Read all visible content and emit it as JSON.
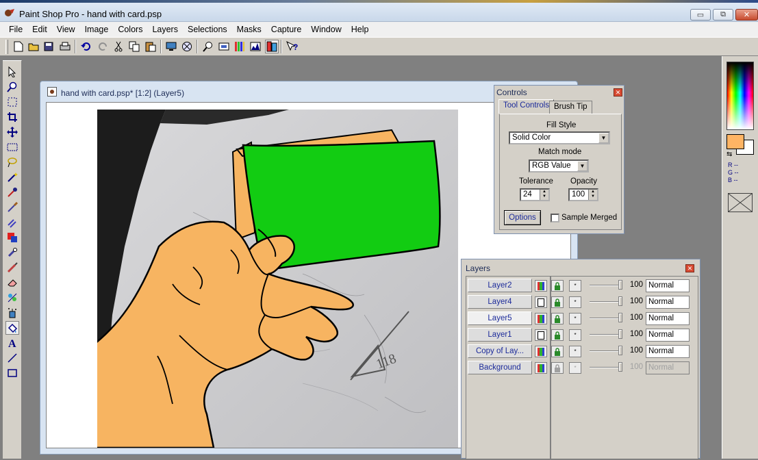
{
  "app": {
    "title": "Paint Shop Pro - hand with card.psp",
    "window_buttons": {
      "minimize": "▭",
      "restore": "⧉",
      "close": "✕"
    }
  },
  "menu": [
    "File",
    "Edit",
    "View",
    "Image",
    "Colors",
    "Layers",
    "Selections",
    "Masks",
    "Capture",
    "Window",
    "Help"
  ],
  "toolbar": [
    "new-icon",
    "open-icon",
    "save-icon",
    "print-icon",
    "undo-icon",
    "redo-icon",
    "cut-icon",
    "copy-icon",
    "paste-icon",
    "screen-icon",
    "browse-icon",
    "zoom-icon",
    "overview-icon",
    "histogram-icon",
    "color-icon",
    "toggle-palettes-icon",
    "help-icon"
  ],
  "tools": [
    "arrow-tool-icon",
    "zoom-tool-icon",
    "deform-tool-icon",
    "crop-tool-icon",
    "mover-tool-icon",
    "selection-tool-icon",
    "freehand-tool-icon",
    "magic-wand-icon",
    "dropper-icon",
    "paint-brush-icon",
    "clone-brush-icon",
    "color-replacer-icon",
    "retouch-icon",
    "scratch-remover-icon",
    "eraser-icon",
    "picture-tube-icon",
    "airbrush-icon",
    "flood-fill-icon",
    "text-tool-icon",
    "line-tool-icon",
    "shapes-tool-icon"
  ],
  "colors": {
    "foreground": "#ffb464",
    "background": "#ffffff",
    "card_green": "#12cc12",
    "hand_tan": "#f7b461",
    "accent_blue": "#1b2a9a"
  },
  "color_readout": {
    "r": "R --",
    "g": "G --",
    "b": "B --"
  },
  "document": {
    "title": "hand with card.psp* [1:2] (Layer5)"
  },
  "controls": {
    "title": "Controls",
    "tabs": [
      "Tool Controls",
      "Brush Tip"
    ],
    "active_tab": "Tool Controls",
    "fill_style_label": "Fill Style",
    "fill_style_value": "Solid Color",
    "match_mode_label": "Match mode",
    "match_mode_value": "RGB Value",
    "tolerance_label": "Tolerance",
    "tolerance_value": "24",
    "opacity_label": "Opacity",
    "opacity_value": "100",
    "options_button": "Options",
    "sample_merged_label": "Sample Merged"
  },
  "layers": {
    "title": "Layers",
    "rows": [
      {
        "name": "Layer2",
        "opacity": "100",
        "blend": "Normal",
        "selected": false,
        "disabled": false
      },
      {
        "name": "Layer4",
        "opacity": "100",
        "blend": "Normal",
        "selected": false,
        "disabled": false
      },
      {
        "name": "Layer5",
        "opacity": "100",
        "blend": "Normal",
        "selected": true,
        "disabled": false
      },
      {
        "name": "Layer1",
        "opacity": "100",
        "blend": "Normal",
        "selected": false,
        "disabled": false
      },
      {
        "name": "Copy of Lay...",
        "opacity": "100",
        "blend": "Normal",
        "selected": false,
        "disabled": false
      },
      {
        "name": "Background",
        "opacity": "100",
        "blend": "Normal",
        "selected": false,
        "disabled": true
      }
    ],
    "link_glyph": "*"
  }
}
